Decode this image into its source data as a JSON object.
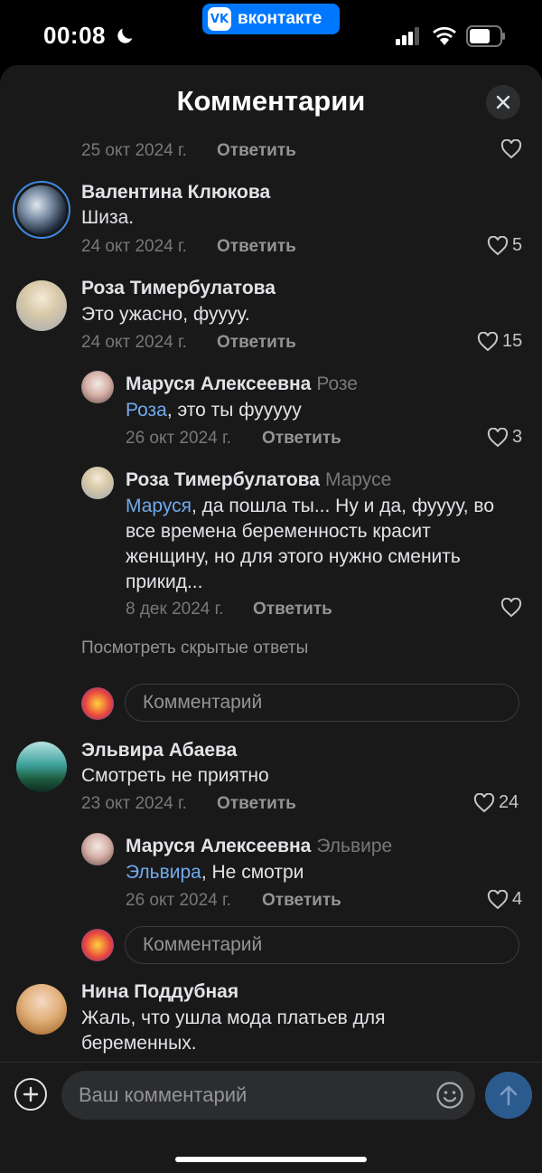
{
  "status": {
    "time": "00:08",
    "app_pill": "вконтакте",
    "app_pill_logo": "VK",
    "icons": [
      "moon-icon",
      "signal-icon",
      "wifi-icon",
      "battery-icon"
    ]
  },
  "header": {
    "title": "Комментарии",
    "close_icon": "close-icon"
  },
  "reply_label": "Ответить",
  "rows": [
    {
      "date": "25 окт 2024 г.",
      "likes": ""
    },
    {
      "name": "Валентина Клюкова",
      "text": "Шиза.",
      "date": "24 окт 2024 г.",
      "likes": "5"
    },
    {
      "name": "Роза Тимербулатова",
      "text": "Это ужасно, фуууу.",
      "date": "24 окт 2024 г.",
      "likes": "15"
    },
    {
      "name": "Маруся Алексеевна",
      "to": "Розе",
      "mention": "Роза",
      "text": ", это ты фууууу",
      "date": "26 окт 2024 г.",
      "likes": "3"
    },
    {
      "name": "Роза Тимербулатова",
      "to": "Марусе",
      "mention": "Маруся",
      "text_lines": [
        ", да  пошла ты... Ну и да, фуууу, во",
        "все времена беременность красит",
        "женщину, но для этого нужно сменить",
        "прикид..."
      ],
      "date": "8 дек 2024 г.",
      "likes": ""
    },
    {
      "name": "Эльвира Абаева",
      "text": "Смотреть не приятно",
      "date": "23 окт 2024 г.",
      "likes": "24"
    },
    {
      "name": "Маруся Алексеевна",
      "to": "Эльвире",
      "mention": "Эльвира",
      "text": ", Не смотри",
      "date": "26 окт 2024 г.",
      "likes": "4"
    },
    {
      "name": "Нина Поддубная",
      "text_lines": [
        "Жаль, что ушла мода платьев для",
        "беременных."
      ]
    }
  ],
  "hidden_replies": "Посмотреть скрытые ответы",
  "comment_placeholder": "Комментарий",
  "composer": {
    "placeholder": "Ваш комментарий",
    "icons": [
      "plus-icon",
      "emoji-icon",
      "send-icon"
    ]
  },
  "colors": {
    "accent": "#0077ff",
    "link": "#71aaeb",
    "background": "#19191a"
  }
}
